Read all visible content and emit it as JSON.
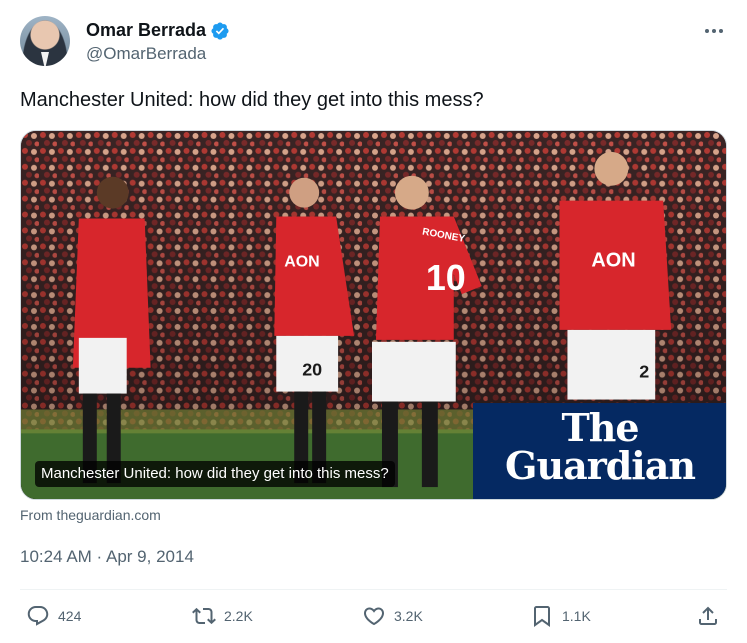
{
  "author": {
    "name": "Omar Berrada",
    "handle": "@OmarBerrada",
    "verified": true
  },
  "tweet": {
    "text": "Manchester United: how did they get into this mess?"
  },
  "card": {
    "caption": "Manchester United: how did they get into this mess?",
    "logo_line1": "The",
    "logo_line2": "Guardian",
    "source": "From theguardian.com",
    "jerseys": {
      "player_a": "20",
      "player_b": "10",
      "player_b_name": "ROONEY",
      "sponsor": "AON",
      "player_d": "2"
    }
  },
  "timestamp": "10:24 AM · Apr 9, 2014",
  "metrics": {
    "replies": "424",
    "retweets": "2.2K",
    "likes": "3.2K",
    "bookmarks": "1.1K"
  },
  "colors": {
    "verified": "#1d9bf0",
    "guardian_blue": "#052962",
    "muted_text": "#536471"
  },
  "icons": [
    "verified-badge-icon",
    "more-options-icon",
    "reply-icon",
    "retweet-icon",
    "like-icon",
    "bookmark-icon",
    "share-icon"
  ]
}
